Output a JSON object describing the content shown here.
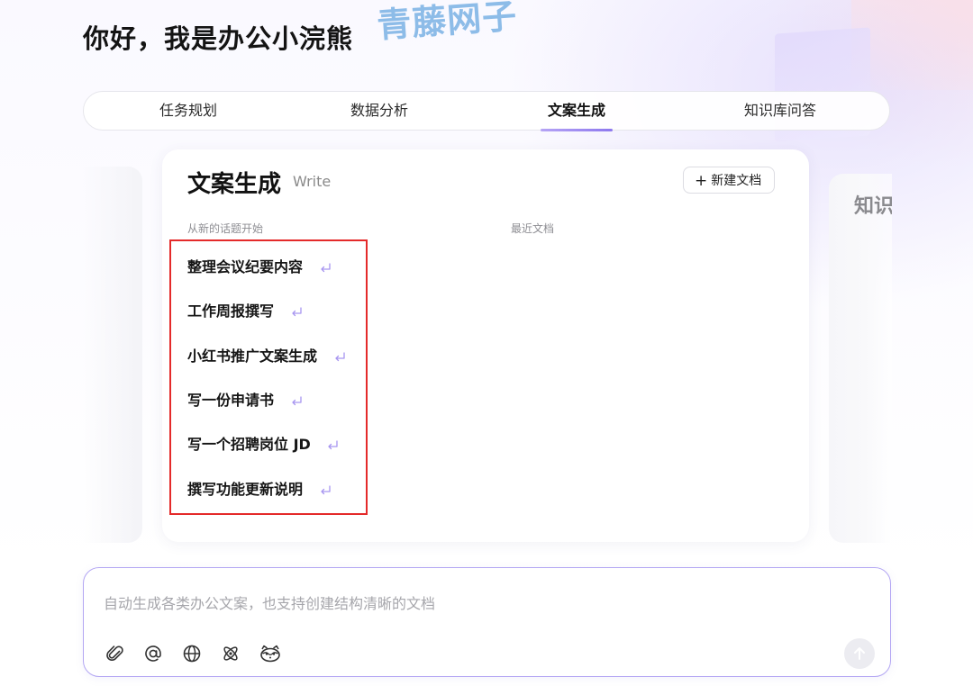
{
  "header": {
    "greeting": "你好，我是办公小浣熊",
    "watermark": "青藤网子"
  },
  "tabs": [
    {
      "label": "任务规划",
      "active": false
    },
    {
      "label": "数据分析",
      "active": false
    },
    {
      "label": "文案生成",
      "active": true
    },
    {
      "label": "知识库问答",
      "active": false
    }
  ],
  "card": {
    "title": "文案生成",
    "subtitle": "Write",
    "new_doc_label": "新建文档",
    "topics_label": "从新的话题开始",
    "recent_label": "最近文档",
    "topics": [
      "整理会议纪要内容",
      "工作周报撰写",
      "小红书推广文案生成",
      "写一份申请书",
      "写一个招聘岗位 JD",
      "撰写功能更新说明"
    ]
  },
  "side_card_right": {
    "title": "知识"
  },
  "input": {
    "placeholder": "自动生成各类办公文案，也支持创建结构清晰的文档"
  },
  "toolbar_icons": [
    "paperclip-icon",
    "at-icon",
    "globe-icon",
    "atom-icon",
    "raccoon-icon",
    "send-arrow-icon"
  ],
  "colors": {
    "accent": "#8e79ee",
    "highlight_border": "#e42a2a",
    "input_border": "#b3a6f3",
    "watermark": "#6eaae1"
  }
}
